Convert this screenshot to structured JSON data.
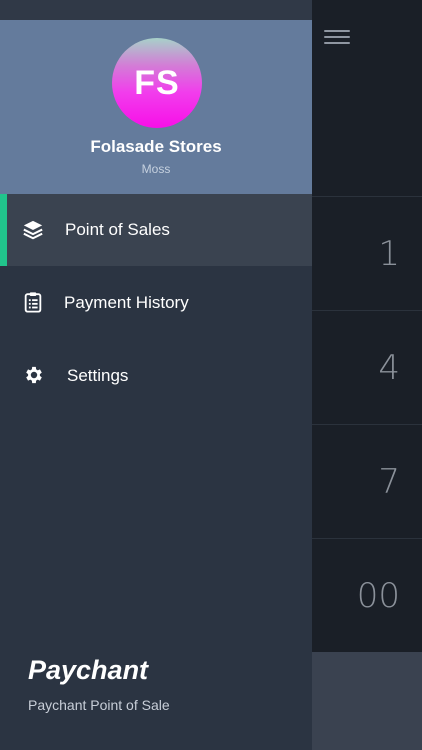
{
  "profile": {
    "initials": "FS",
    "name": "Folasade Stores",
    "subtitle": "Moss"
  },
  "nav": {
    "items": [
      {
        "label": "Point of Sales",
        "icon": "layers-icon",
        "active": true
      },
      {
        "label": "Payment History",
        "icon": "clipboard-icon",
        "active": false
      },
      {
        "label": "Settings",
        "icon": "gear-icon",
        "active": false
      }
    ]
  },
  "footer": {
    "brand": "Paychant",
    "tagline": "Paychant Point of Sale"
  },
  "keypad": {
    "keys": [
      "1",
      "4",
      "7",
      "00"
    ]
  },
  "colors": {
    "drawer_bg": "#2b3442",
    "profile_bg": "#647b9c",
    "accent": "#21c48c",
    "avatar_gradient_end": "#f80fe8"
  }
}
